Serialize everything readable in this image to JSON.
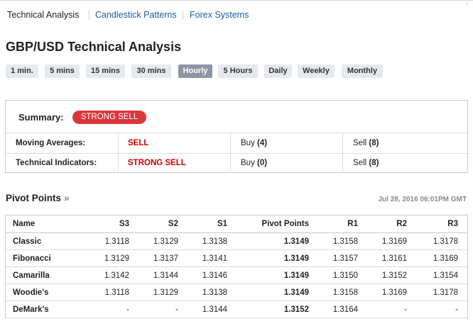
{
  "nav": {
    "tabs": [
      {
        "label": "Technical Analysis",
        "active": true
      },
      {
        "label": "Candlestick Patterns",
        "active": false
      },
      {
        "label": "Forex Systems",
        "active": false
      }
    ]
  },
  "page_title": "GBP/USD Technical Analysis",
  "timeframes": [
    {
      "label": "1 min.",
      "active": false
    },
    {
      "label": "5 mins",
      "active": false
    },
    {
      "label": "15 mins",
      "active": false
    },
    {
      "label": "30 mins",
      "active": false
    },
    {
      "label": "Hourly",
      "active": true
    },
    {
      "label": "5 Hours",
      "active": false
    },
    {
      "label": "Daily",
      "active": false
    },
    {
      "label": "Weekly",
      "active": false
    },
    {
      "label": "Monthly",
      "active": false
    }
  ],
  "summary": {
    "label": "Summary:",
    "badge": "STRONG SELL",
    "badge_color": "#d8373b",
    "rows": [
      {
        "label": "Moving Averages:",
        "signal": "SELL",
        "buy_label": "Buy",
        "buy_count": "(4)",
        "sell_label": "Sell",
        "sell_count": "(8)"
      },
      {
        "label": "Technical Indicators:",
        "signal": "STRONG SELL",
        "buy_label": "Buy",
        "buy_count": "(0)",
        "sell_label": "Sell",
        "sell_count": "(8)"
      }
    ]
  },
  "pivot": {
    "title": "Pivot Points",
    "title_suffix": "»",
    "timestamp": "Jul 28, 2016 06:01PM GMT",
    "columns": [
      "Name",
      "S3",
      "S2",
      "S1",
      "Pivot Points",
      "R1",
      "R2",
      "R3"
    ],
    "rows": [
      [
        "Classic",
        "1.3118",
        "1.3129",
        "1.3138",
        "1.3149",
        "1.3158",
        "1.3169",
        "1.3178"
      ],
      [
        "Fibonacci",
        "1.3129",
        "1.3137",
        "1.3141",
        "1.3149",
        "1.3157",
        "1.3161",
        "1.3169"
      ],
      [
        "Camarilla",
        "1.3142",
        "1.3144",
        "1.3146",
        "1.3149",
        "1.3150",
        "1.3152",
        "1.3154"
      ],
      [
        "Woodie's",
        "1.3118",
        "1.3129",
        "1.3138",
        "1.3149",
        "1.3158",
        "1.3169",
        "1.3178"
      ],
      [
        "DeMark's",
        "-",
        "-",
        "1.3144",
        "1.3152",
        "1.3164",
        "-",
        "-"
      ]
    ]
  },
  "colors": {
    "link": "#1a5e9a",
    "sell_red": "#cc0000",
    "active_button": "#8c96a3",
    "button_bg": "#e6e9ed"
  }
}
